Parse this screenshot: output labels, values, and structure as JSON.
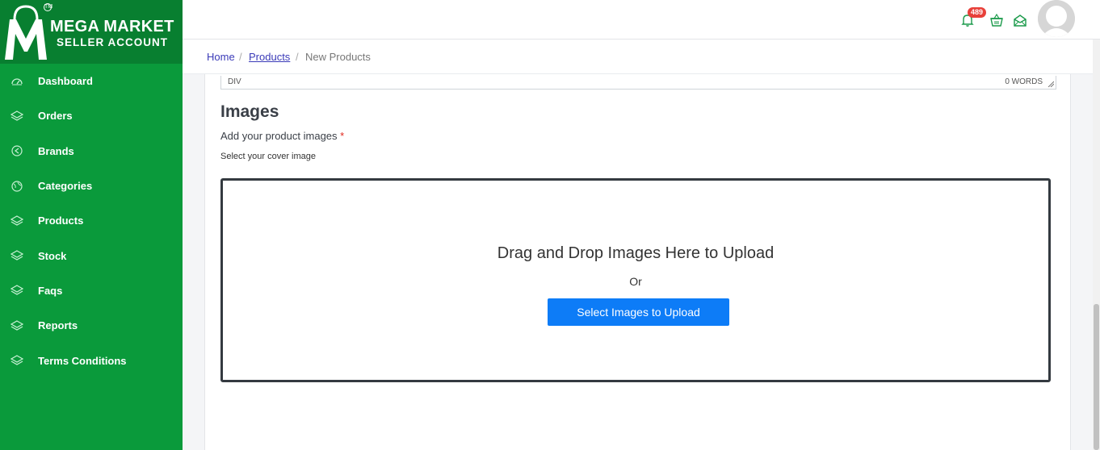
{
  "brand": {
    "title": "MEGA MARKET",
    "subtitle": "SELLER ACCOUNT",
    "trademark": "TM",
    "logo_letter": "M"
  },
  "sidebar": {
    "items": [
      {
        "label": "Dashboard",
        "icon": "gauge-icon"
      },
      {
        "label": "Orders",
        "icon": "layers-icon"
      },
      {
        "label": "Brands",
        "icon": "tag-circle-icon"
      },
      {
        "label": "Categories",
        "icon": "globe-icon"
      },
      {
        "label": "Products",
        "icon": "layers-icon"
      },
      {
        "label": "Stock",
        "icon": "layers-icon"
      },
      {
        "label": "Faqs",
        "icon": "layers-icon"
      },
      {
        "label": "Reports",
        "icon": "layers-icon"
      },
      {
        "label": "Terms Conditions",
        "icon": "layers-icon"
      }
    ]
  },
  "header": {
    "notification_count": "489"
  },
  "breadcrumb": {
    "home": "Home",
    "separator": "/",
    "products": "Products",
    "current": "New Products"
  },
  "editor": {
    "path": "DIV",
    "word_count": "0 WORDS"
  },
  "images_section": {
    "title": "Images",
    "label": "Add your product images",
    "required_mark": "*",
    "help": "Select your cover image",
    "dropzone_title": "Drag and Drop Images Here to Upload",
    "or_text": "Or",
    "button_label": "Select Images to Upload"
  },
  "colors": {
    "sidebar": "#0a9a3b",
    "logo_bg": "#087f30",
    "accent": "#0d7cf7",
    "badge": "#e8403a",
    "header_icon": "#1a9a4a"
  }
}
